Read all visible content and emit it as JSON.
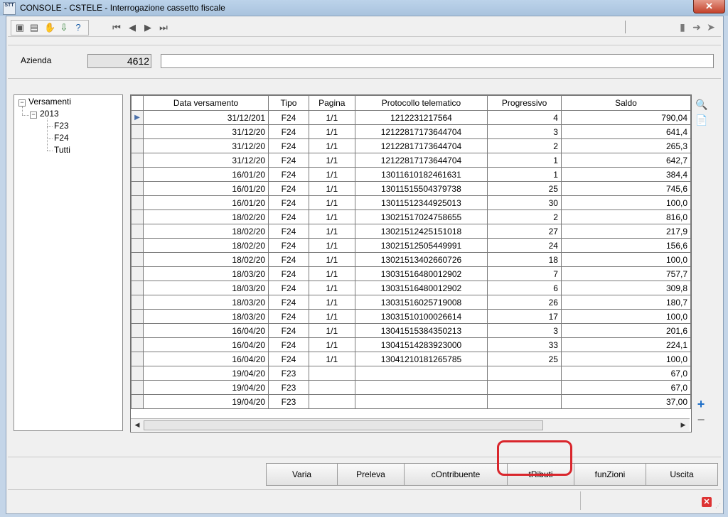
{
  "window": {
    "app_icon": "STT",
    "title": "CONSOLE  - CSTELE -  Interrogazione cassetto fiscale",
    "close_glyph": "✕"
  },
  "toolbar": {
    "icons": [
      "screen-icon",
      "print-icon",
      "hand-icon",
      "download-icon",
      "help-icon"
    ],
    "nav": [
      "first-record-icon",
      "prev-record-icon",
      "next-record-icon",
      "last-record-icon"
    ],
    "right_icons": [
      "document-icon",
      "forward-icon",
      "send-icon"
    ]
  },
  "header": {
    "azienda_label": "Azienda",
    "azienda_code": "4612",
    "azienda_name": ""
  },
  "tree": {
    "root": "Versamenti",
    "year": "2013",
    "children": [
      "F23",
      "F24",
      "Tutti"
    ]
  },
  "grid": {
    "columns": [
      "Data versamento",
      "Tipo",
      "Pagina",
      "Protocollo telematico",
      "Progressivo",
      "Saldo"
    ],
    "rows": [
      {
        "data": "31/12/201",
        "tipo": "F24",
        "pagina": "1/1",
        "protocollo": "1212231217564",
        "progressivo": "4",
        "saldo": "790,04"
      },
      {
        "data": "31/12/20",
        "tipo": "F24",
        "pagina": "1/1",
        "protocollo": "12122817173644704",
        "progressivo": "3",
        "saldo": "641,4"
      },
      {
        "data": "31/12/20",
        "tipo": "F24",
        "pagina": "1/1",
        "protocollo": "12122817173644704",
        "progressivo": "2",
        "saldo": "265,3"
      },
      {
        "data": "31/12/20",
        "tipo": "F24",
        "pagina": "1/1",
        "protocollo": "12122817173644704",
        "progressivo": "1",
        "saldo": "642,7"
      },
      {
        "data": "16/01/20",
        "tipo": "F24",
        "pagina": "1/1",
        "protocollo": "13011610182461631",
        "progressivo": "1",
        "saldo": "384,4"
      },
      {
        "data": "16/01/20",
        "tipo": "F24",
        "pagina": "1/1",
        "protocollo": "13011515504379738",
        "progressivo": "25",
        "saldo": "745,6"
      },
      {
        "data": "16/01/20",
        "tipo": "F24",
        "pagina": "1/1",
        "protocollo": "13011512344925013",
        "progressivo": "30",
        "saldo": "100,0"
      },
      {
        "data": "18/02/20",
        "tipo": "F24",
        "pagina": "1/1",
        "protocollo": "13021517024758655",
        "progressivo": "2",
        "saldo": "816,0"
      },
      {
        "data": "18/02/20",
        "tipo": "F24",
        "pagina": "1/1",
        "protocollo": "13021512425151018",
        "progressivo": "27",
        "saldo": "217,9"
      },
      {
        "data": "18/02/20",
        "tipo": "F24",
        "pagina": "1/1",
        "protocollo": "13021512505449991",
        "progressivo": "24",
        "saldo": "156,6"
      },
      {
        "data": "18/02/20",
        "tipo": "F24",
        "pagina": "1/1",
        "protocollo": "13021513402660726",
        "progressivo": "18",
        "saldo": "100,0"
      },
      {
        "data": "18/03/20",
        "tipo": "F24",
        "pagina": "1/1",
        "protocollo": "13031516480012902",
        "progressivo": "7",
        "saldo": "757,7"
      },
      {
        "data": "18/03/20",
        "tipo": "F24",
        "pagina": "1/1",
        "protocollo": "13031516480012902",
        "progressivo": "6",
        "saldo": "309,8"
      },
      {
        "data": "18/03/20",
        "tipo": "F24",
        "pagina": "1/1",
        "protocollo": "13031516025719008",
        "progressivo": "26",
        "saldo": "180,7"
      },
      {
        "data": "18/03/20",
        "tipo": "F24",
        "pagina": "1/1",
        "protocollo": "13031510100026614",
        "progressivo": "17",
        "saldo": "100,0"
      },
      {
        "data": "16/04/20",
        "tipo": "F24",
        "pagina": "1/1",
        "protocollo": "13041515384350213",
        "progressivo": "3",
        "saldo": "201,6"
      },
      {
        "data": "16/04/20",
        "tipo": "F24",
        "pagina": "1/1",
        "protocollo": "13041514283923000",
        "progressivo": "33",
        "saldo": "224,1"
      },
      {
        "data": "16/04/20",
        "tipo": "F24",
        "pagina": "1/1",
        "protocollo": "13041210181265785",
        "progressivo": "25",
        "saldo": "100,0"
      },
      {
        "data": "19/04/20",
        "tipo": "F23",
        "pagina": "",
        "protocollo": "",
        "progressivo": "",
        "saldo": "67,0"
      },
      {
        "data": "19/04/20",
        "tipo": "F23",
        "pagina": "",
        "protocollo": "",
        "progressivo": "",
        "saldo": "67,0"
      },
      {
        "data": "19/04/20",
        "tipo": "F23",
        "pagina": "",
        "protocollo": "",
        "progressivo": "",
        "saldo": "37,00"
      }
    ],
    "selected_row_marker": "▶"
  },
  "side_actions": {
    "search_icon": "🔍",
    "pdf_icon": "📄",
    "add_icon": "+",
    "remove_icon": "−"
  },
  "buttons": {
    "varia": "Varia",
    "preleva": "Preleva",
    "contribuente": "cOntribuente",
    "tributi": "tRibuti",
    "funzioni": "funZioni",
    "uscita": "Uscita"
  },
  "status": {
    "close_glyph": "✕"
  }
}
